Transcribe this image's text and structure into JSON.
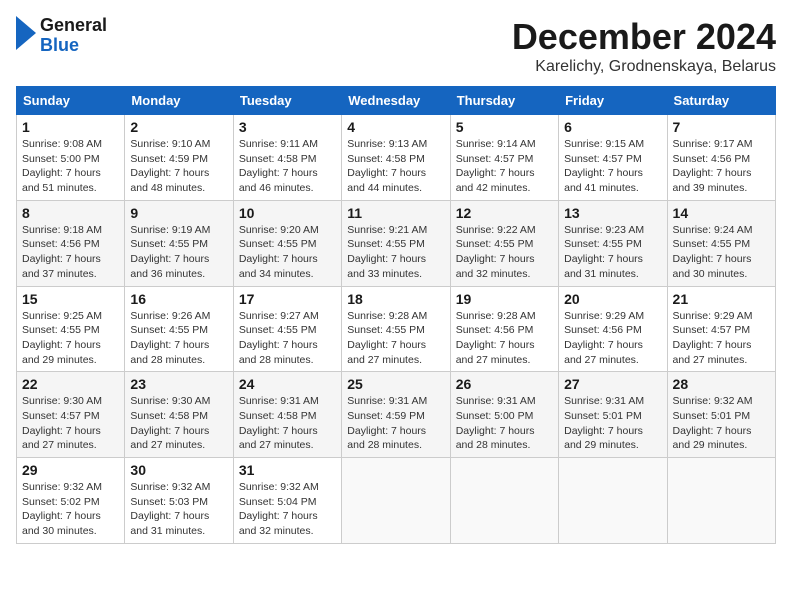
{
  "header": {
    "logo_line1": "General",
    "logo_line2": "Blue",
    "title": "December 2024",
    "subtitle": "Karelichy, Grodnenskaya, Belarus"
  },
  "calendar": {
    "days_of_week": [
      "Sunday",
      "Monday",
      "Tuesday",
      "Wednesday",
      "Thursday",
      "Friday",
      "Saturday"
    ],
    "weeks": [
      [
        {
          "day": "1",
          "sunrise": "9:08 AM",
          "sunset": "5:00 PM",
          "daylight": "7 hours and 51 minutes."
        },
        {
          "day": "2",
          "sunrise": "9:10 AM",
          "sunset": "4:59 PM",
          "daylight": "7 hours and 48 minutes."
        },
        {
          "day": "3",
          "sunrise": "9:11 AM",
          "sunset": "4:58 PM",
          "daylight": "7 hours and 46 minutes."
        },
        {
          "day": "4",
          "sunrise": "9:13 AM",
          "sunset": "4:58 PM",
          "daylight": "7 hours and 44 minutes."
        },
        {
          "day": "5",
          "sunrise": "9:14 AM",
          "sunset": "4:57 PM",
          "daylight": "7 hours and 42 minutes."
        },
        {
          "day": "6",
          "sunrise": "9:15 AM",
          "sunset": "4:57 PM",
          "daylight": "7 hours and 41 minutes."
        },
        {
          "day": "7",
          "sunrise": "9:17 AM",
          "sunset": "4:56 PM",
          "daylight": "7 hours and 39 minutes."
        }
      ],
      [
        {
          "day": "8",
          "sunrise": "9:18 AM",
          "sunset": "4:56 PM",
          "daylight": "7 hours and 37 minutes."
        },
        {
          "day": "9",
          "sunrise": "9:19 AM",
          "sunset": "4:55 PM",
          "daylight": "7 hours and 36 minutes."
        },
        {
          "day": "10",
          "sunrise": "9:20 AM",
          "sunset": "4:55 PM",
          "daylight": "7 hours and 34 minutes."
        },
        {
          "day": "11",
          "sunrise": "9:21 AM",
          "sunset": "4:55 PM",
          "daylight": "7 hours and 33 minutes."
        },
        {
          "day": "12",
          "sunrise": "9:22 AM",
          "sunset": "4:55 PM",
          "daylight": "7 hours and 32 minutes."
        },
        {
          "day": "13",
          "sunrise": "9:23 AM",
          "sunset": "4:55 PM",
          "daylight": "7 hours and 31 minutes."
        },
        {
          "day": "14",
          "sunrise": "9:24 AM",
          "sunset": "4:55 PM",
          "daylight": "7 hours and 30 minutes."
        }
      ],
      [
        {
          "day": "15",
          "sunrise": "9:25 AM",
          "sunset": "4:55 PM",
          "daylight": "7 hours and 29 minutes."
        },
        {
          "day": "16",
          "sunrise": "9:26 AM",
          "sunset": "4:55 PM",
          "daylight": "7 hours and 28 minutes."
        },
        {
          "day": "17",
          "sunrise": "9:27 AM",
          "sunset": "4:55 PM",
          "daylight": "7 hours and 28 minutes."
        },
        {
          "day": "18",
          "sunrise": "9:28 AM",
          "sunset": "4:55 PM",
          "daylight": "7 hours and 27 minutes."
        },
        {
          "day": "19",
          "sunrise": "9:28 AM",
          "sunset": "4:56 PM",
          "daylight": "7 hours and 27 minutes."
        },
        {
          "day": "20",
          "sunrise": "9:29 AM",
          "sunset": "4:56 PM",
          "daylight": "7 hours and 27 minutes."
        },
        {
          "day": "21",
          "sunrise": "9:29 AM",
          "sunset": "4:57 PM",
          "daylight": "7 hours and 27 minutes."
        }
      ],
      [
        {
          "day": "22",
          "sunrise": "9:30 AM",
          "sunset": "4:57 PM",
          "daylight": "7 hours and 27 minutes."
        },
        {
          "day": "23",
          "sunrise": "9:30 AM",
          "sunset": "4:58 PM",
          "daylight": "7 hours and 27 minutes."
        },
        {
          "day": "24",
          "sunrise": "9:31 AM",
          "sunset": "4:58 PM",
          "daylight": "7 hours and 27 minutes."
        },
        {
          "day": "25",
          "sunrise": "9:31 AM",
          "sunset": "4:59 PM",
          "daylight": "7 hours and 28 minutes."
        },
        {
          "day": "26",
          "sunrise": "9:31 AM",
          "sunset": "5:00 PM",
          "daylight": "7 hours and 28 minutes."
        },
        {
          "day": "27",
          "sunrise": "9:31 AM",
          "sunset": "5:01 PM",
          "daylight": "7 hours and 29 minutes."
        },
        {
          "day": "28",
          "sunrise": "9:32 AM",
          "sunset": "5:01 PM",
          "daylight": "7 hours and 29 minutes."
        }
      ],
      [
        {
          "day": "29",
          "sunrise": "9:32 AM",
          "sunset": "5:02 PM",
          "daylight": "7 hours and 30 minutes."
        },
        {
          "day": "30",
          "sunrise": "9:32 AM",
          "sunset": "5:03 PM",
          "daylight": "7 hours and 31 minutes."
        },
        {
          "day": "31",
          "sunrise": "9:32 AM",
          "sunset": "5:04 PM",
          "daylight": "7 hours and 32 minutes."
        },
        null,
        null,
        null,
        null
      ]
    ]
  }
}
